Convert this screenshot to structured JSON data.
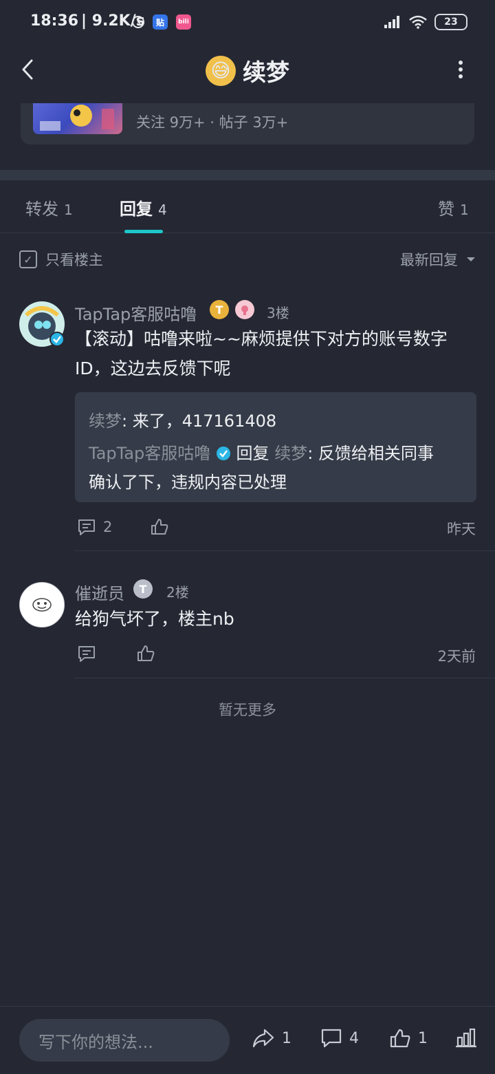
{
  "status_bar": {
    "time": "18:36",
    "net_speed": "| 9.2K/s",
    "app_icon_1": "贴",
    "app_icon_2": "bili",
    "battery": "23"
  },
  "header": {
    "title": "续梦",
    "title_emoji": "😅"
  },
  "forum_card": {
    "stats": "关注 9万+ · 帖子 3万+"
  },
  "tabs": [
    {
      "label": "转发",
      "count": "1"
    },
    {
      "label": "回复",
      "count": "4"
    },
    {
      "label": "赞",
      "count": "1"
    }
  ],
  "filter": {
    "only_op": "只看楼主",
    "sort": "最新回复"
  },
  "replies": [
    {
      "name": "TapTap客服咕噜",
      "badge": "T",
      "floor": "3楼",
      "text": "【滚动】咕噜来啦~~麻烦提供下对方的账号数字ID，这边去反馈下呢",
      "sub_replies": {
        "r1_author": "续梦",
        "r1_text": ": 来了，417161408",
        "r2_author": "TapTap客服咕噜",
        "r2_reply_word": "回复",
        "r2_target": "续梦",
        "r2_text_a": ": 反馈给相关同事",
        "r2_text_b": "确认了下，违规内容已处理"
      },
      "comment_count": "2",
      "time": "昨天"
    },
    {
      "name": "催逝员",
      "badge": "T",
      "floor": "2楼",
      "text": "给狗气坏了，楼主nb",
      "time": "2天前"
    }
  ],
  "end_text": "暂无更多",
  "bottom_bar": {
    "input_placeholder": "写下你的想法...",
    "share_count": "1",
    "comment_count": "4",
    "like_count": "1"
  },
  "colors": {
    "background": "#252833",
    "accent": "#1ec7c9",
    "verified": "#2bb6e6"
  }
}
